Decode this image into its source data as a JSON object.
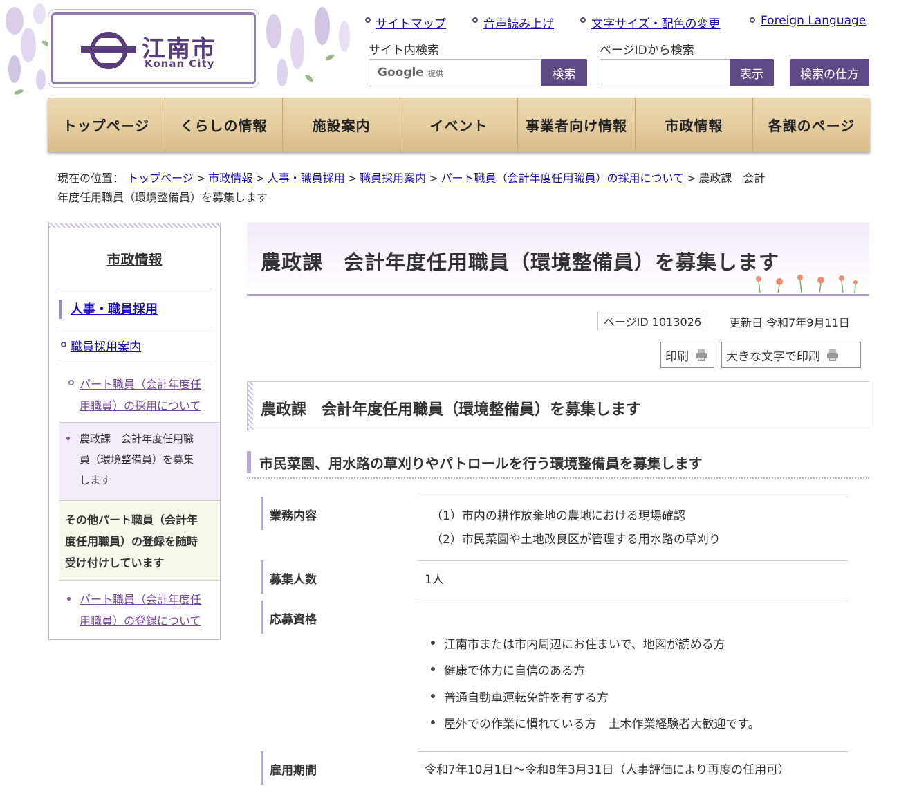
{
  "header": {
    "logo_ja": "江南市",
    "logo_en": "Konan City",
    "utility_links": [
      "サイトマップ",
      "音声読み上げ",
      "文字サイズ・配色の変更",
      "Foreign Language"
    ],
    "site_search_label": "サイト内検索",
    "google_label": "Google",
    "google_sub": "提供",
    "search_button": "検索",
    "pageid_search_label": "ページIDから検索",
    "show_button": "表示",
    "howto_button": "検索の仕方"
  },
  "nav": [
    "トップページ",
    "くらしの情報",
    "施設案内",
    "イベント",
    "事業者向け情報",
    "市政情報",
    "各課のページ"
  ],
  "breadcrumb": {
    "prefix": "現在の位置：",
    "links": [
      "トップページ",
      "市政情報",
      "人事・職員採用",
      "職員採用案内",
      "パート職員（会計年度任用職員）の採用について"
    ],
    "sep": ">",
    "current_line1": "農政課　会計",
    "current_line2": "年度任用職員（環境整備員）を募集します"
  },
  "sidebar": {
    "title": "市政情報",
    "level1": "人事・職員採用",
    "level2": "職員採用案内",
    "level3_link_l1": "パート職員（会計年度任",
    "level3_link_l2": "用職員）の採用について",
    "current_l1": "農政課　会計年度任用職",
    "current_l2": "員（環境整備員）を募集",
    "current_l3": "します",
    "other_l1": "その他パート職員（会計年",
    "other_l2": "度任用職員）の登録を随時",
    "other_l3": "受け付けしています",
    "reg_link_l1": "パート職員（会計年度任",
    "reg_link_l2": "用職員）の登録について"
  },
  "main": {
    "title": "農政課　会計年度任用職員（環境整備員）を募集します",
    "page_id": "ページID 1013026",
    "updated": "更新日 令和7年9月11日",
    "print": "印刷",
    "print_large": "大きな文字で印刷",
    "h2": "農政課　会計年度任用職員（環境整備員）を募集します",
    "h3": "市民菜園、用水路の草刈りやパトロールを行う環境整備員を募集します",
    "rows": {
      "work_label": "業務内容",
      "work_1": "（1）市内の耕作放棄地の農地における現場確認",
      "work_2": "（2）市民菜園や土地改良区が管理する用水路の草刈り",
      "count_label": "募集人数",
      "count_value": "1人",
      "qual_label": "応募資格",
      "qual_items": [
        "江南市または市内周辺にお住まいで、地図が読める方",
        "健康で体力に自信のある方",
        "普通自動車運転免許を有する方",
        "屋外での作業に慣れている方　土木作業経験者大歓迎です。"
      ],
      "period_label": "雇用期間",
      "period_value": "令和7年10月1日～令和8年3月31日（人事評価により再度の任用可）"
    }
  },
  "colors": {
    "accent": "#5e4a85",
    "nav_wood": "#e3cb9c",
    "lavender": "#b7aad6"
  }
}
